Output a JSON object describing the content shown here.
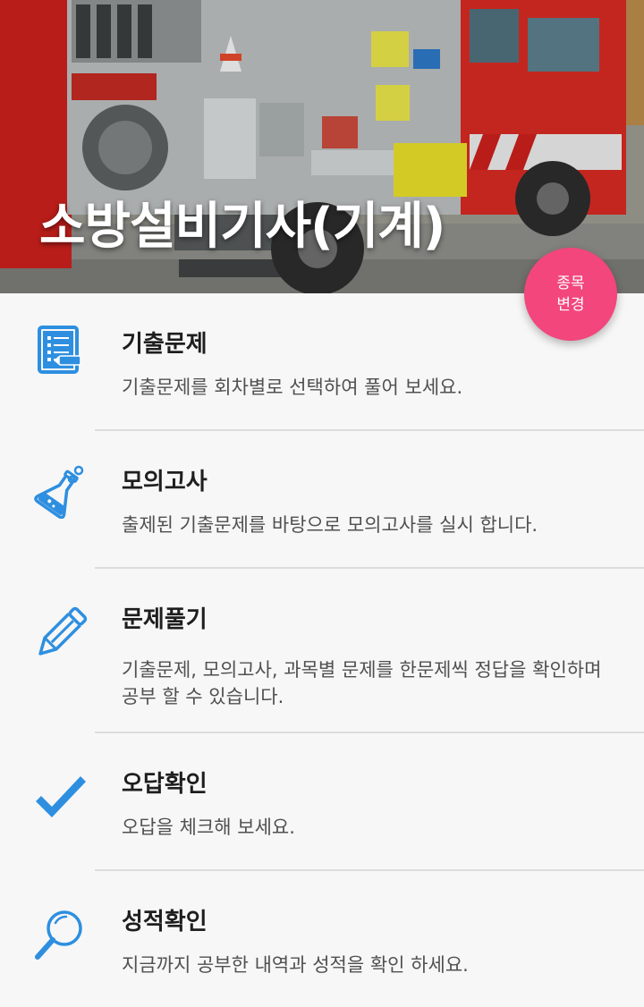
{
  "header": {
    "title": "소방설비기사(기계)"
  },
  "fab": {
    "line1": "종목",
    "line2": "변경"
  },
  "colors": {
    "icon_blue": "#2e8fe0",
    "fab_pink": "#f2467c",
    "background": "#f7f7f7"
  },
  "menu": {
    "items": [
      {
        "icon": "exam-sheet-icon",
        "title": "기출문제",
        "desc": "기출문제를 회차별로 선택하여 풀어 보세요."
      },
      {
        "icon": "flask-icon",
        "title": "모의고사",
        "desc": "출제된 기출문제를 바탕으로 모의고사를 실시 합니다."
      },
      {
        "icon": "pencil-icon",
        "title": "문제풀기",
        "desc": "기출문제, 모의고사, 과목별 문제를 한문제씩 정답을 확인하며 공부 할 수 있습니다."
      },
      {
        "icon": "checkmark-icon",
        "title": "오답확인",
        "desc": "오답을 체크해 보세요."
      },
      {
        "icon": "magnifier-icon",
        "title": "성적확인",
        "desc": "지금까지 공부한 내역과 성적을 확인 하세요."
      }
    ]
  }
}
